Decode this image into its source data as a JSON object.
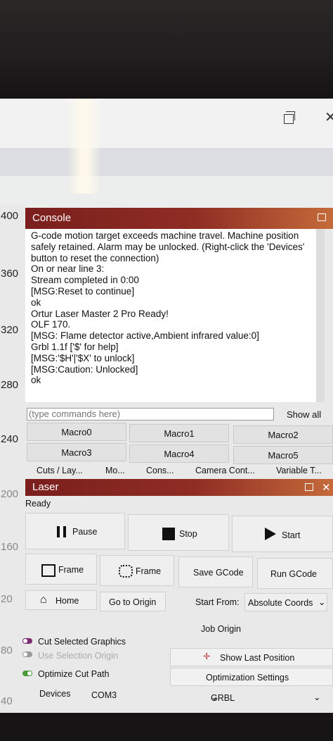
{
  "ruler_marks": [
    "400",
    "360",
    "320",
    "280",
    "240",
    "200",
    "160",
    "20",
    "80",
    "40"
  ],
  "console": {
    "title": "Console",
    "lines": [
      "G-code motion target exceeds machine travel. Machine position safely retained. Alarm may be unlocked. (Right-click the 'Devices' button to reset the connection)",
      "On or near line 3:",
      "Stream completed in 0:00",
      "[MSG:Reset to continue]",
      "ok",
      "Ortur Laser Master 2 Pro Ready!",
      "OLF 170.",
      "[MSG: Flame detector active,Ambient infrared value:0]",
      "Grbl 1.1f ['$' for help]",
      "[MSG:'$H'|'$X' to unlock]",
      "[MSG:Caution: Unlocked]",
      "ok"
    ],
    "input_placeholder": "(type commands here)",
    "show_all": "Show all",
    "macros": [
      "Macro0",
      "Macro1",
      "Macro2",
      "Macro3",
      "Macro4",
      "Macro5"
    ]
  },
  "tabs": [
    "Cuts / Lay...",
    "Mo...",
    "Cons...",
    "Camera Cont...",
    "Variable T..."
  ],
  "laser": {
    "title": "Laser",
    "status": "Ready",
    "pause": "Pause",
    "stop": "Stop",
    "start": "Start",
    "frame1": "Frame",
    "frame2": "Frame",
    "save_gcode": "Save GCode",
    "run_gcode": "Run GCode",
    "home": "Home",
    "go_to_origin": "Go to Origin",
    "start_from_label": "Start From:",
    "start_from_value": "Absolute Coords",
    "job_origin": "Job Origin",
    "cut_selected": "Cut Selected Graphics",
    "use_selection_origin": "Use Selection Origin",
    "optimize_cut_path": "Optimize Cut Path",
    "show_last_position": "Show Last Position",
    "optimization_settings": "Optimization Settings",
    "devices_label": "Devices",
    "port": "COM3",
    "controller": "GRBL"
  },
  "colors": {
    "header_start": "#7a1f1d",
    "header_end": "#c46a3a",
    "toggle_on": "#4a9a3c",
    "toggle_off": "#7b2d6e"
  }
}
